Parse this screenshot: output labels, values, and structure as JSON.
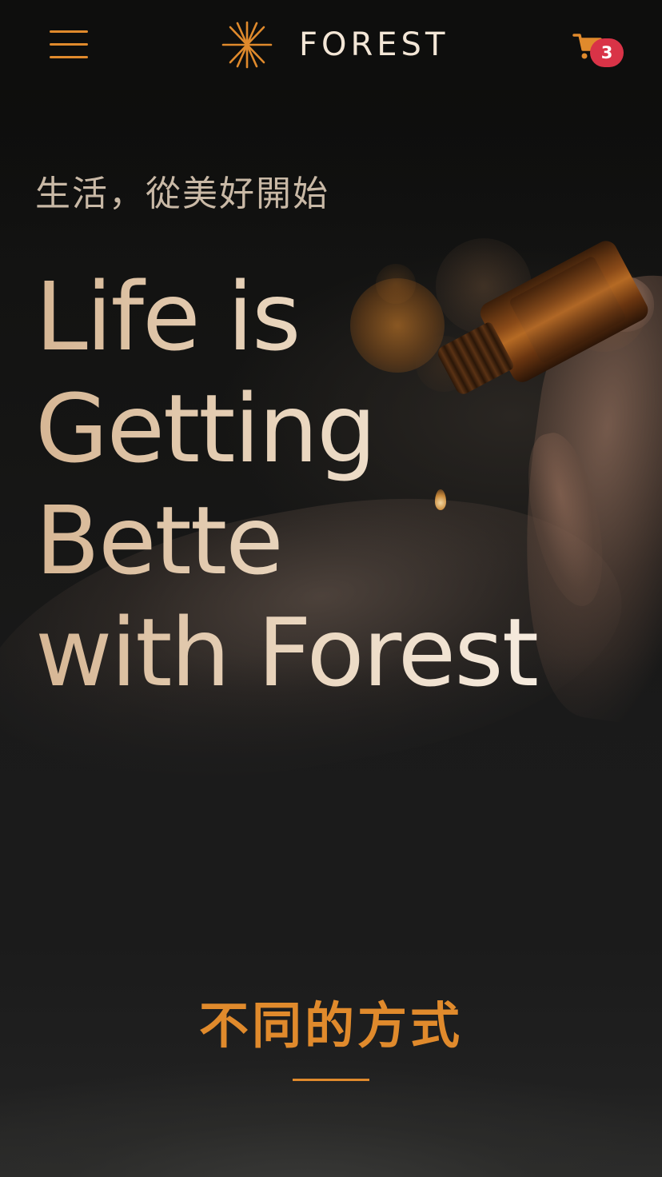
{
  "header": {
    "brand": "FOREST",
    "menu_icon": "hamburger-menu-icon",
    "logo_icon": "asterisk-spark-icon",
    "cart_icon": "shopping-cart-icon",
    "cart_count": "3"
  },
  "hero": {
    "subtitle": "生活，從美好開始",
    "title_lines": [
      "Life is",
      "Getting",
      "Bette",
      "with Forest"
    ]
  },
  "section": {
    "title": "不同的方式"
  },
  "colors": {
    "accent": "#e08a2c",
    "badge": "#d93347",
    "background": "#1b1b1b",
    "header": "#0e0e0d",
    "subtitle_text": "#c9b9a6",
    "title_gradient_start": "#d6b694",
    "title_gradient_end": "#fbf4ec",
    "brand_text": "#f3e6d6"
  }
}
